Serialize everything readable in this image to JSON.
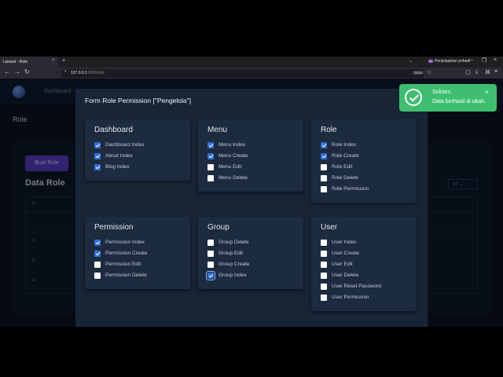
{
  "browser": {
    "tab_title": "Laravel - Role",
    "tab_close": "×",
    "new_tab": "+",
    "tab_list": "⌄",
    "private_label": "Penjelajahan pribadi",
    "window_controls": [
      "–",
      "❐",
      "×"
    ],
    "nav_buttons": [
      "←",
      "→",
      "↻"
    ],
    "url_host": "127.0.0.1",
    "url_rest": ":8000/role",
    "zoom": "110%",
    "toolbar_icons": [
      "pocket-icon",
      "download-icon",
      "extensions-icon",
      "menu-icon"
    ]
  },
  "app": {
    "nav_dashboard": "Dashboard",
    "page_title": "Role",
    "create_button": "Buat Role",
    "section_title": "Data Role",
    "page_size": "10",
    "table_header_hash": "#",
    "row_numbers": [
      "1.",
      "2.",
      "3."
    ]
  },
  "modal": {
    "title": "Form Role Permission [\"Pengelola\"]",
    "groups": [
      {
        "title": "Dashboard",
        "items": [
          {
            "label": "Dashboard Index",
            "checked": true
          },
          {
            "label": "About Index",
            "checked": true
          },
          {
            "label": "Blog Index",
            "checked": true
          }
        ]
      },
      {
        "title": "Menu",
        "items": [
          {
            "label": "Menu Index",
            "checked": true
          },
          {
            "label": "Menu Create",
            "checked": true
          },
          {
            "label": "Menu Edit",
            "checked": false
          },
          {
            "label": "Menu Delete",
            "checked": false
          }
        ]
      },
      {
        "title": "Role",
        "items": [
          {
            "label": "Role Index",
            "checked": true
          },
          {
            "label": "Role Create",
            "checked": true
          },
          {
            "label": "Role Edit",
            "checked": false
          },
          {
            "label": "Role Delete",
            "checked": false
          },
          {
            "label": "Role Permission",
            "checked": false
          }
        ]
      },
      {
        "title": "Permission",
        "items": [
          {
            "label": "Permission Index",
            "checked": true
          },
          {
            "label": "Permission Create",
            "checked": true
          },
          {
            "label": "Permission Edit",
            "checked": false
          },
          {
            "label": "Permission Delete",
            "checked": false
          }
        ]
      },
      {
        "title": "Group",
        "items": [
          {
            "label": "Group Delete",
            "checked": false
          },
          {
            "label": "Group Edit",
            "checked": false
          },
          {
            "label": "Group Create",
            "checked": false
          },
          {
            "label": "Group Index",
            "checked": true,
            "focused": true
          }
        ]
      },
      {
        "title": "User",
        "items": [
          {
            "label": "User Index",
            "checked": false
          },
          {
            "label": "User Create",
            "checked": false
          },
          {
            "label": "User Edit",
            "checked": false
          },
          {
            "label": "User Delete",
            "checked": false
          },
          {
            "label": "User Reset Password",
            "checked": false
          },
          {
            "label": "User Permission",
            "checked": false
          }
        ]
      }
    ]
  },
  "toast": {
    "title": "Sukses.",
    "message": "Data berhasil di ubah.",
    "close": "×",
    "color": "#3ebf6f"
  }
}
